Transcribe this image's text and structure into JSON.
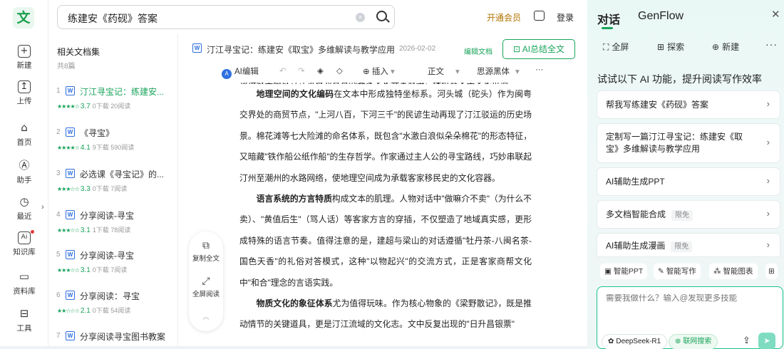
{
  "colors": {
    "accent": "#19a45a",
    "vip": "#b07400",
    "word_icon": "#2f6fe0"
  },
  "nav": {
    "logo": "文",
    "items": [
      {
        "label": "新建",
        "icon": "plus-square-icon",
        "glyph": "+"
      },
      {
        "label": "上传",
        "icon": "upload-icon",
        "glyph": "↥"
      },
      {
        "label": "首页",
        "icon": "home-icon",
        "glyph": "⌂"
      },
      {
        "label": "助手",
        "icon": "assistant-icon",
        "glyph": "Ⓐ"
      },
      {
        "label": "最近",
        "icon": "clock-icon",
        "glyph": "◷"
      },
      {
        "label": "知识库",
        "icon": "ai-knowledge-icon",
        "glyph": "Ai"
      },
      {
        "label": "资料库",
        "icon": "folder-icon",
        "glyph": "▭"
      },
      {
        "label": "工具",
        "icon": "toolbox-icon",
        "glyph": "⊟"
      }
    ]
  },
  "topbar": {
    "search_value": "练建安《药砚》答案",
    "vip": "开通会员",
    "login": "登录"
  },
  "doclist": {
    "title": "相关文档集",
    "count": "共8篇",
    "items": [
      {
        "num": "1",
        "title": "汀江寻宝记：练建安...",
        "score": "3.7",
        "stars": "★★★★☆",
        "stats": "0下载 20阅读",
        "active": true
      },
      {
        "num": "2",
        "title": "《寻宝》",
        "score": "4.1",
        "stars": "★★★★☆",
        "stats": "9下载 590阅读",
        "active": false
      },
      {
        "num": "3",
        "title": "必选课《寻宝记》的...",
        "score": "3.3",
        "stars": "★★★☆☆",
        "stats": "0下载 7阅读",
        "active": false
      },
      {
        "num": "4",
        "title": "分享阅读-寻宝",
        "score": "3.1",
        "stars": "★★★☆☆",
        "stats": "1下载 78阅读",
        "active": false
      },
      {
        "num": "5",
        "title": "分享阅读-寻宝",
        "score": "3.1",
        "stars": "★★★☆☆",
        "stats": "0下载 7阅读",
        "active": false
      },
      {
        "num": "6",
        "title": "分享阅读：寻宝",
        "score": "2.1",
        "stars": "★★☆☆☆",
        "stats": "0下载 54阅读",
        "active": false
      },
      {
        "num": "7",
        "title": "分享阅读寻宝图书教案",
        "score": "",
        "stars": "",
        "stats": "",
        "active": false
      }
    ]
  },
  "doc": {
    "title": "汀江寻宝记：练建安《取宝》多维解读与教学应用",
    "date": "2026-02-02",
    "edit": "编辑文档",
    "ai_summary": "AI总结全文",
    "toolbar": {
      "ai_edit": "AI编辑",
      "insert": "插入",
      "style": "正文",
      "font": "思源黑体",
      "more": "···"
    },
    "paragraphs": [
      {
        "bold": "地理空间的文化编码",
        "text": "在文本中形成独特坐标系。河头城（砣头）作为闽粤交界处的商贸节点，\"上河八百，下河三千\"的民谚生动再现了汀江驳运的历史场景。棉花滩等七大险滩的命名体系，既包含\"水激白浪似朵朵棉花\"的形态特征，又暗藏\"铁作船公纸作船\"的生存哲学。作家通过主人公的寻宝路线，巧妙串联起汀州至潮州的水路网络，使地理空间成为承载客家移民史的文化容器。"
      },
      {
        "bold": "语言系统的方言特质",
        "text": "构成文本的肌理。人物对话中\"做嘛介不卖\"（为什么不卖）、\"黄值后生\"（骂人话）等客家方言的穿插，不仅塑造了地域真实感，更形成特殊的语言节奏。值得注意的是，建超与梁山的对话遵循\"牡丹茶-八闽名茶-国色天香\"的礼俗对答模式，这种\"以物起兴\"的交流方式，正是客家商帮文化中\"和合\"理念的言语实践。"
      },
      {
        "bold": "物质文化的象征体系",
        "text": "尤为值得玩味。作为核心物象的《梁野散记》，既是推动情节的关键道具，更是汀江流域的文化志。文中反复出现的\"日升昌银票\""
      }
    ]
  },
  "side_tools": {
    "copy": "复制全文",
    "fullscreen": "全屏阅读"
  },
  "panel": {
    "tabs": [
      "对话",
      "GenFlow"
    ],
    "actions": [
      {
        "label": "全屏",
        "icon": "expand-icon",
        "glyph": "⛶"
      },
      {
        "label": "探索",
        "icon": "grid-icon",
        "glyph": "⊞"
      },
      {
        "label": "新建",
        "icon": "new-chat-icon",
        "glyph": "⊕"
      }
    ],
    "more": "···",
    "hint": "试试以下 AI 功能，提升阅读写作效率",
    "suggestions": [
      {
        "text": "帮我写练建安《药砚》答案",
        "tag": ""
      },
      {
        "text": "定制写一篇汀江寻宝记：练建安《取宝》多维解读与教学应用",
        "tag": ""
      },
      {
        "text": "AI辅助生成PPT",
        "tag": ""
      },
      {
        "text": "多文档智能合成",
        "tag": "限免"
      },
      {
        "text": "AI辅助生成漫画",
        "tag": "限免"
      }
    ],
    "chips": [
      {
        "label": "智能PPT",
        "icon": "ppt-icon",
        "glyph": "▣"
      },
      {
        "label": "智能写作",
        "icon": "pen-icon",
        "glyph": "✎"
      },
      {
        "label": "智能图表",
        "icon": "chart-icon",
        "glyph": "⁂"
      }
    ],
    "input_placeholder": "需要我做什么？输入@发现更多技能",
    "model": "DeepSeek-R1",
    "web_search": "联网搜索"
  }
}
